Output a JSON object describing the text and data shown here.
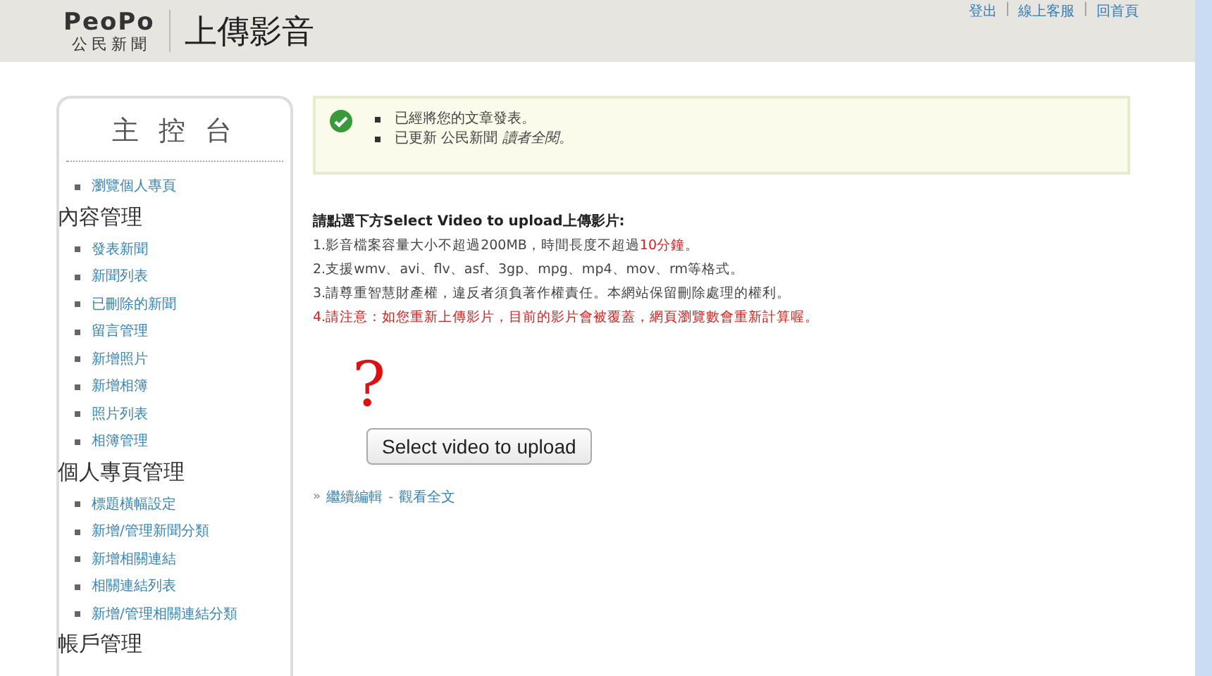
{
  "header": {
    "logo": "PeoPo",
    "logo_sub": [
      "公",
      "民",
      "新",
      "聞"
    ],
    "title": "上傳影音",
    "links": [
      "登出",
      "線上客服",
      "回首頁"
    ],
    "link_separator": "|"
  },
  "sidebar": {
    "title": "主 控 台",
    "top_items": [
      "瀏覽個人專頁"
    ],
    "sections": [
      {
        "heading": "內容管理",
        "items": [
          "發表新聞",
          "新聞列表",
          "已刪除的新聞",
          "留言管理",
          "新增照片",
          "新增相簿",
          "照片列表",
          "相簿管理"
        ]
      },
      {
        "heading": "個人專頁管理",
        "items": [
          "標題橫幅設定",
          "新增/管理新聞分類",
          "新增相關連結",
          "相關連結列表",
          "新增/管理相關連結分類"
        ]
      },
      {
        "heading": "帳戶管理"
      }
    ]
  },
  "notice": {
    "messages": [
      "已經將您的文章發表。",
      "已更新 公民新聞 *讀者全閱*。"
    ]
  },
  "instructions": {
    "heading": "請點選下方Select Video to upload上傳影片:",
    "lines": [
      [
        {
          "text": "1.影音檔案容量大小不超過200MB，時間長度不超過",
          "highlight": false
        },
        {
          "text": "10分鐘",
          "highlight": true
        },
        {
          "text": "。",
          "highlight": false
        }
      ],
      [
        {
          "text": "2.支援wmv、avi、flv、asf、3gp、mpg、mp4、mov、rm等格式。",
          "highlight": false
        }
      ],
      [
        {
          "text": "3.請尊重智慧財產權，違反者須負著作權責任。本網站保留刪除處理的權利。",
          "highlight": false
        }
      ],
      [
        {
          "text": "4.請注意：如您重新上傳影片，目前的影片會被覆蓋，網頁瀏覽數會重新計算喔。",
          "highlight": true
        }
      ]
    ]
  },
  "plugin_placeholder": "?",
  "upload_button": "Select video to upload",
  "footer": {
    "arrow": "»",
    "separator": "-",
    "links": [
      "繼續編輯",
      "觀看全文"
    ]
  }
}
